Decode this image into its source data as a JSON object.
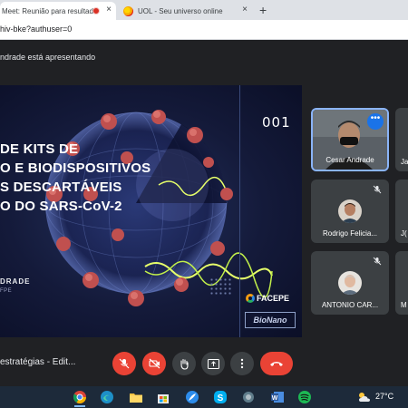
{
  "browser": {
    "tabs": [
      {
        "label": "Meet: Reunião para resultad",
        "active": true,
        "recording": true
      },
      {
        "label": "UOL - Seu universo online",
        "active": false
      }
    ],
    "new_tab": "+",
    "close": "×",
    "url": "hiv-bke?authuser=0"
  },
  "meet": {
    "presenting_banner": "ndrade está apresentando",
    "meeting_title": "estratégias - Edit...",
    "slide": {
      "title_lines": [
        "DE KITS DE",
        "O E BIODISPOSITIVOS",
        "S DESCARTÁVEIS",
        "O DO SARS-CoV-2"
      ],
      "number": "001",
      "presenter_name": "DRADE",
      "presenter_affil": "FPE",
      "logo_facepe": "FACEPE",
      "logo_bionano": "BioNano"
    },
    "participants": [
      {
        "name": "Cesar Andrade",
        "speaking": true
      },
      {
        "name": "Ja"
      },
      {
        "name": "Rodrigo Felicia..."
      },
      {
        "name": "J("
      },
      {
        "name": "ANTONIO CAR..."
      },
      {
        "name": "M"
      }
    ]
  },
  "taskbar": {
    "temperature": "27°C",
    "icons": [
      "chrome-icon",
      "edge-icon",
      "file-explorer-icon",
      "store-icon",
      "feather-icon",
      "skype-icon",
      "camera-app-icon",
      "word-icon",
      "spotify-icon",
      "weather-icon"
    ]
  },
  "colors": {
    "meet_bg": "#202124",
    "tile_bg": "#3c4043",
    "end_call_red": "#ea4335",
    "active_border": "#8ab4f8",
    "slide_bg": "#141a3a"
  }
}
